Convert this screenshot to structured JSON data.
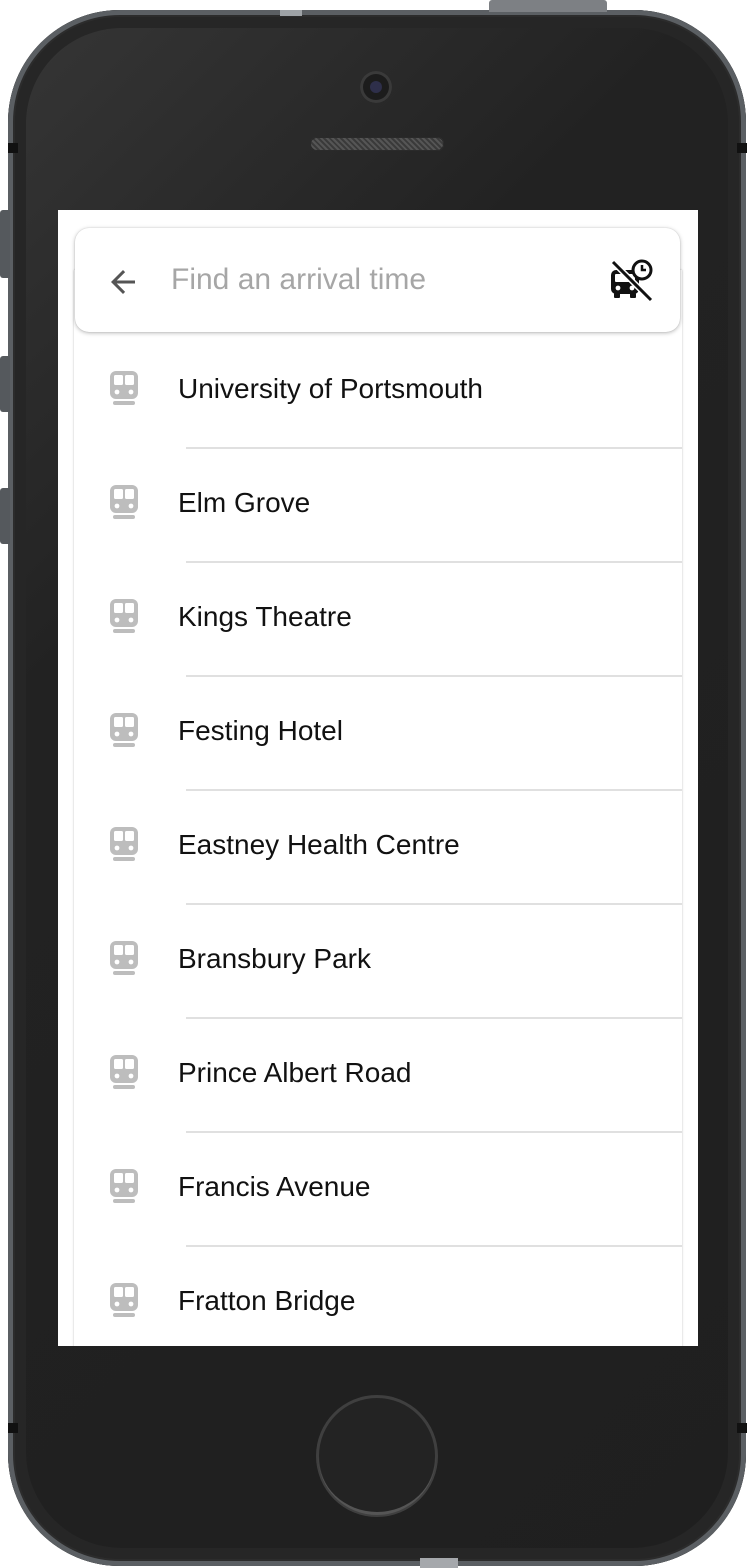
{
  "search": {
    "placeholder": "Find an arrival time",
    "value": ""
  },
  "icons": {
    "back": "arrow-back-icon",
    "action": "bus-alert-off-icon",
    "stop": "train-icon"
  },
  "colors": {
    "stop_icon": "#bdbdbd",
    "text": "#111111",
    "placeholder": "#a6a6a6"
  },
  "stops": [
    {
      "name": "University of Portsmouth"
    },
    {
      "name": "Elm Grove"
    },
    {
      "name": "Kings Theatre"
    },
    {
      "name": "Festing Hotel"
    },
    {
      "name": "Eastney Health Centre"
    },
    {
      "name": "Bransbury Park"
    },
    {
      "name": "Prince Albert Road"
    },
    {
      "name": "Francis Avenue"
    },
    {
      "name": "Fratton Bridge"
    }
  ]
}
